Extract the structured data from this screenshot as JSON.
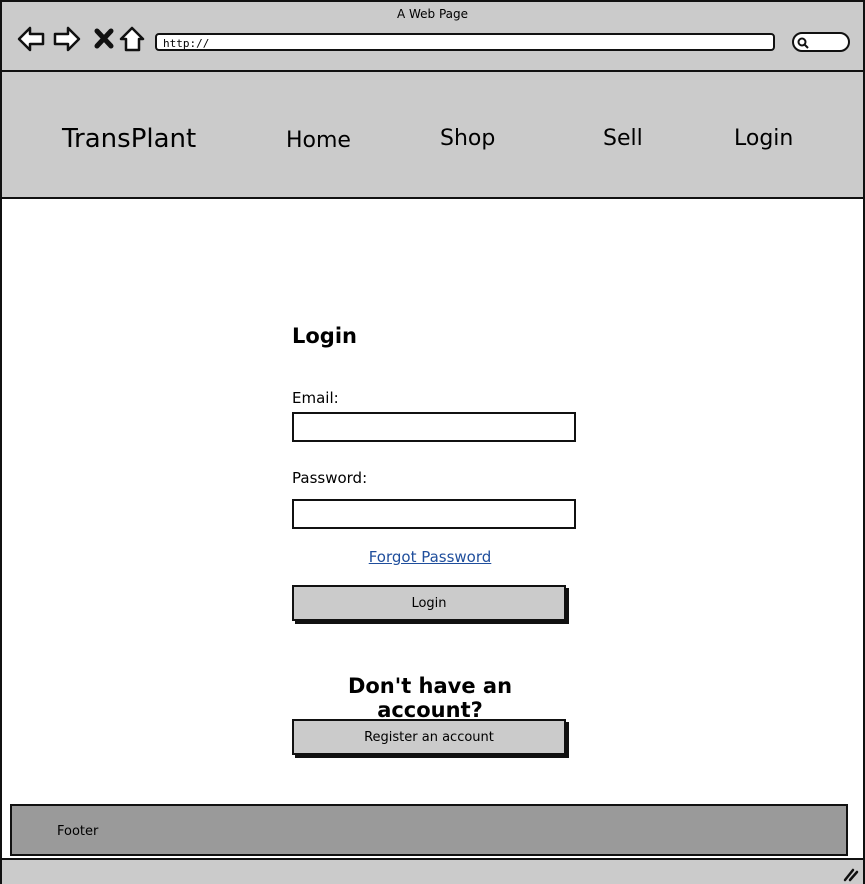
{
  "browser": {
    "window_title": "A Web Page",
    "url": "http://",
    "icons": {
      "back": "back-arrow-icon",
      "forward": "forward-arrow-icon",
      "stop": "close-icon",
      "home": "home-icon",
      "search": "search-icon",
      "resize": "resize-grip-icon"
    }
  },
  "header": {
    "brand": "TransPlant",
    "nav": [
      {
        "label": "Home"
      },
      {
        "label": "Shop"
      },
      {
        "label": "Sell"
      },
      {
        "label": "Login"
      }
    ]
  },
  "login": {
    "title": "Login",
    "email_label": "Email:",
    "email_value": "",
    "password_label": "Password:",
    "password_value": "",
    "forgot_link": "Forgot Password",
    "submit_label": "Login",
    "no_account_heading": "Don't have an account?",
    "register_label": "Register an account"
  },
  "footer": {
    "label": "Footer"
  },
  "colors": {
    "chrome_gray": "#cbcbcb",
    "footer_gray": "#9a9a9a",
    "link_blue": "#1f4e9c"
  }
}
